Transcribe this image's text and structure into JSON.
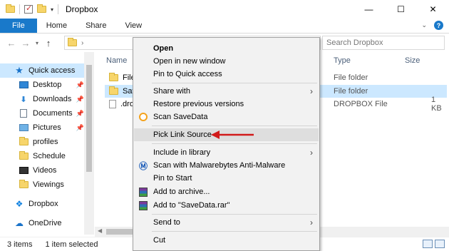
{
  "window": {
    "title": "Dropbox",
    "controls": {
      "minimize": "—",
      "maximize": "☐",
      "close": "✕"
    }
  },
  "ribbon": {
    "tabs": [
      "File",
      "Home",
      "Share",
      "View"
    ]
  },
  "address": {
    "path_text": "",
    "search_placeholder": "Search Dropbox"
  },
  "nav_pane": {
    "items": [
      {
        "label": "Quick access",
        "icon": "star-icon"
      },
      {
        "label": "Desktop",
        "icon": "desktop-icon",
        "pinned": true
      },
      {
        "label": "Downloads",
        "icon": "download-icon",
        "pinned": true
      },
      {
        "label": "Documents",
        "icon": "documents-icon",
        "pinned": true
      },
      {
        "label": "Pictures",
        "icon": "pictures-icon",
        "pinned": true
      },
      {
        "label": "profiles",
        "icon": "folder-icon"
      },
      {
        "label": "Schedule",
        "icon": "folder-icon"
      },
      {
        "label": "Videos",
        "icon": "videos-icon"
      },
      {
        "label": "Viewings",
        "icon": "folder-icon"
      },
      {
        "label": "Dropbox",
        "icon": "dropbox-icon"
      },
      {
        "label": "OneDrive",
        "icon": "onedrive-icon"
      }
    ]
  },
  "content": {
    "columns": {
      "name": "Name",
      "type": "Type",
      "size": "Size"
    },
    "files": [
      {
        "name": "File",
        "type": "File folder",
        "size": ""
      },
      {
        "name": "Save",
        "type": "File folder",
        "size": ""
      },
      {
        "name": ".dro",
        "type": "DROPBOX File",
        "size": "1 KB"
      }
    ]
  },
  "status": {
    "items_count": "3 items",
    "selected": "1 item selected"
  },
  "context_menu": {
    "items": [
      {
        "label": "Open",
        "bold": true
      },
      {
        "label": "Open in new window"
      },
      {
        "label": "Pin to Quick access"
      },
      {
        "label": "Share with",
        "submenu": true
      },
      {
        "label": "Restore previous versions"
      },
      {
        "label": "Scan SaveData",
        "icon": "savedata-icon"
      },
      {
        "label": "Pick Link Source",
        "highlighted": true
      },
      {
        "label": "Include in library",
        "submenu": true
      },
      {
        "label": "Scan with Malwarebytes Anti-Malware",
        "icon": "malwarebytes-icon"
      },
      {
        "label": "Pin to Start"
      },
      {
        "label": "Add to archive...",
        "icon": "winrar-icon"
      },
      {
        "label": "Add to \"SaveData.rar\"",
        "icon": "winrar-icon"
      },
      {
        "label": "Send to",
        "submenu": true
      },
      {
        "label": "Cut"
      }
    ]
  },
  "annotation_color": "#d11a1a"
}
